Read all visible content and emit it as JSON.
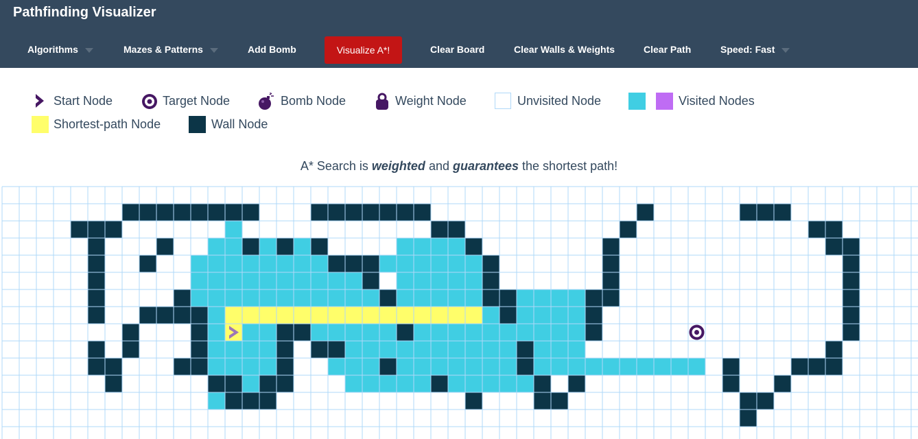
{
  "app": {
    "title": "Pathfinding Visualizer"
  },
  "nav": {
    "algorithms": "Algorithms",
    "mazes": "Mazes & Patterns",
    "add_bomb": "Add Bomb",
    "visualize": "Visualize A*!",
    "clear_board": "Clear Board",
    "clear_walls": "Clear Walls & Weights",
    "clear_path": "Clear Path",
    "speed": "Speed: Fast"
  },
  "legend": {
    "start": "Start Node",
    "target": "Target Node",
    "bomb": "Bomb Node",
    "weight": "Weight Node",
    "unvisited": "Unvisited Node",
    "visited": "Visited Nodes",
    "shortest": "Shortest-path Node",
    "wall": "Wall Node"
  },
  "description": {
    "prefix": "A* Search is ",
    "bold1": "weighted",
    "middle": " and ",
    "bold2": "guarantees",
    "suffix": " the shortest path!"
  },
  "colors": {
    "navbar": "#34495e",
    "visualize_button": "#c31515",
    "wall": "#0c3547",
    "visited": "#40cee3",
    "visited_alt": "#bf6cf4",
    "shortest_path": "#fffe6a",
    "grid_line": "#afd8f8",
    "start_target": "#461763"
  },
  "board": {
    "start_node": {
      "row": 8,
      "col": 13
    },
    "target_node": {
      "row": 8,
      "col": 40
    },
    "walls": [
      [
        1,
        7
      ],
      [
        1,
        8
      ],
      [
        1,
        9
      ],
      [
        1,
        10
      ],
      [
        1,
        11
      ],
      [
        1,
        12
      ],
      [
        1,
        13
      ],
      [
        1,
        14
      ],
      [
        1,
        18
      ],
      [
        1,
        19
      ],
      [
        1,
        20
      ],
      [
        1,
        21
      ],
      [
        1,
        22
      ],
      [
        1,
        23
      ],
      [
        1,
        24
      ],
      [
        1,
        37
      ],
      [
        1,
        43
      ],
      [
        1,
        44
      ],
      [
        1,
        45
      ],
      [
        2,
        4
      ],
      [
        2,
        5
      ],
      [
        2,
        6
      ],
      [
        2,
        25
      ],
      [
        2,
        26
      ],
      [
        2,
        36
      ],
      [
        2,
        47
      ],
      [
        2,
        48
      ],
      [
        3,
        5
      ],
      [
        3,
        9
      ],
      [
        3,
        14
      ],
      [
        3,
        16
      ],
      [
        3,
        18
      ],
      [
        3,
        27
      ],
      [
        3,
        35
      ],
      [
        3,
        48
      ],
      [
        3,
        49
      ],
      [
        4,
        5
      ],
      [
        4,
        8
      ],
      [
        4,
        19
      ],
      [
        4,
        20
      ],
      [
        4,
        21
      ],
      [
        4,
        28
      ],
      [
        4,
        35
      ],
      [
        4,
        49
      ],
      [
        5,
        5
      ],
      [
        5,
        21
      ],
      [
        5,
        28
      ],
      [
        5,
        35
      ],
      [
        5,
        49
      ],
      [
        6,
        5
      ],
      [
        6,
        10
      ],
      [
        6,
        22
      ],
      [
        6,
        28
      ],
      [
        6,
        29
      ],
      [
        6,
        34
      ],
      [
        6,
        35
      ],
      [
        6,
        49
      ],
      [
        7,
        5
      ],
      [
        7,
        8
      ],
      [
        7,
        9
      ],
      [
        7,
        10
      ],
      [
        7,
        11
      ],
      [
        7,
        29
      ],
      [
        7,
        34
      ],
      [
        7,
        49
      ],
      [
        8,
        7
      ],
      [
        8,
        11
      ],
      [
        8,
        16
      ],
      [
        8,
        17
      ],
      [
        8,
        23
      ],
      [
        8,
        34
      ],
      [
        8,
        49
      ],
      [
        9,
        5
      ],
      [
        9,
        7
      ],
      [
        9,
        11
      ],
      [
        9,
        16
      ],
      [
        9,
        18
      ],
      [
        9,
        19
      ],
      [
        9,
        30
      ],
      [
        9,
        48
      ],
      [
        10,
        5
      ],
      [
        10,
        6
      ],
      [
        10,
        10
      ],
      [
        10,
        11
      ],
      [
        10,
        16
      ],
      [
        10,
        22
      ],
      [
        10,
        30
      ],
      [
        10,
        42
      ],
      [
        10,
        46
      ],
      [
        10,
        47
      ],
      [
        10,
        48
      ],
      [
        11,
        6
      ],
      [
        11,
        12
      ],
      [
        11,
        13
      ],
      [
        11,
        15
      ],
      [
        11,
        16
      ],
      [
        11,
        25
      ],
      [
        11,
        31
      ],
      [
        11,
        33
      ],
      [
        11,
        42
      ],
      [
        11,
        45
      ],
      [
        12,
        13
      ],
      [
        12,
        14
      ],
      [
        12,
        15
      ],
      [
        12,
        27
      ],
      [
        12,
        31
      ],
      [
        12,
        32
      ],
      [
        12,
        43
      ],
      [
        12,
        44
      ],
      [
        13,
        43
      ]
    ],
    "visited_rect_ranges": [
      [
        2,
        13,
        13
      ],
      [
        3,
        12,
        18
      ],
      [
        3,
        23,
        27
      ],
      [
        4,
        11,
        20
      ],
      [
        4,
        22,
        27
      ],
      [
        5,
        11,
        21
      ],
      [
        5,
        23,
        28
      ],
      [
        6,
        11,
        21
      ],
      [
        6,
        23,
        27
      ],
      [
        6,
        30,
        33
      ],
      [
        7,
        12,
        28
      ],
      [
        7,
        30,
        33
      ],
      [
        8,
        11,
        15
      ],
      [
        8,
        18,
        22
      ],
      [
        8,
        24,
        33
      ],
      [
        9,
        11,
        15
      ],
      [
        9,
        20,
        29
      ],
      [
        9,
        31,
        33
      ],
      [
        10,
        12,
        15
      ],
      [
        10,
        19,
        21
      ],
      [
        10,
        23,
        29
      ],
      [
        10,
        31,
        40
      ],
      [
        11,
        14,
        14
      ],
      [
        11,
        20,
        24
      ],
      [
        11,
        26,
        30
      ],
      [
        12,
        12,
        12
      ]
    ],
    "shortest_path": [
      [
        7,
        13
      ],
      [
        7,
        14
      ],
      [
        7,
        15
      ],
      [
        7,
        16
      ],
      [
        7,
        17
      ],
      [
        7,
        18
      ],
      [
        7,
        19
      ],
      [
        7,
        20
      ],
      [
        7,
        21
      ],
      [
        7,
        22
      ],
      [
        7,
        23
      ],
      [
        7,
        24
      ],
      [
        7,
        25
      ],
      [
        7,
        26
      ],
      [
        7,
        27
      ],
      [
        8,
        13
      ]
    ]
  }
}
